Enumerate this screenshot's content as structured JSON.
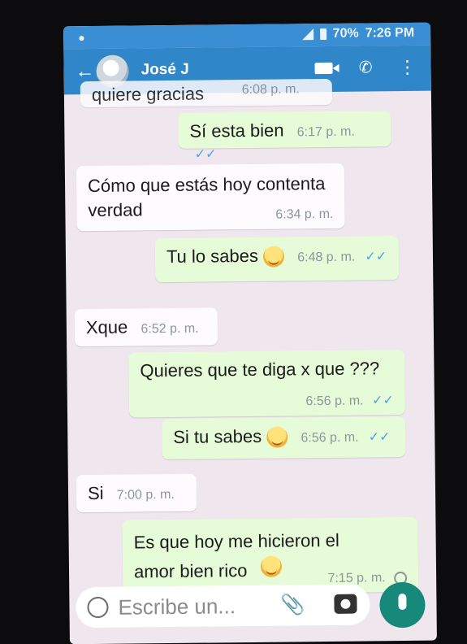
{
  "status_bar": {
    "battery": "70%",
    "time": "7:26 PM"
  },
  "app_bar": {
    "contact_name": "José J"
  },
  "messages": [
    {
      "text": "quiere gracias",
      "time": "6:08 p. m.",
      "dir": "in"
    },
    {
      "text": "Sí esta bien",
      "time": "6:17 p. m.",
      "dir": "out"
    },
    {
      "text": "Cómo que estás hoy contenta verdad",
      "time": "6:34 p. m.",
      "dir": "in"
    },
    {
      "text": "Tu lo sabes",
      "time": "6:48 p. m.",
      "dir": "out"
    },
    {
      "text": "Xque",
      "time": "6:52 p. m.",
      "dir": "in"
    },
    {
      "text": "Quieres que te diga x que ???",
      "time": "6:56 p. m.",
      "dir": "out"
    },
    {
      "text": "Si tu sabes",
      "time": "6:56 p. m.",
      "dir": "out"
    },
    {
      "text": "Si",
      "time": "7:00 p. m.",
      "dir": "in"
    },
    {
      "text": "Es que hoy me hicieron el amor bien rico",
      "time": "7:15 p. m.",
      "dir": "out"
    }
  ],
  "input_bar": {
    "placeholder": "Escribe un..."
  },
  "icons": {
    "back": "back-arrow-icon",
    "video": "video-call-icon",
    "phone": "phone-call-icon",
    "more": "more-options-icon",
    "emoji": "smiley-icon",
    "attach": "attach-clip-icon",
    "camera": "camera-icon",
    "mic": "mic-icon",
    "read": "double-check-icon",
    "pending": "clock-icon"
  },
  "colors": {
    "app_bar": "#2f86c9",
    "out_bubble": "#e6fbd8",
    "in_bubble": "#fdfbfd",
    "read_ticks": "#4fa0e8",
    "mic_button": "#16897b"
  }
}
